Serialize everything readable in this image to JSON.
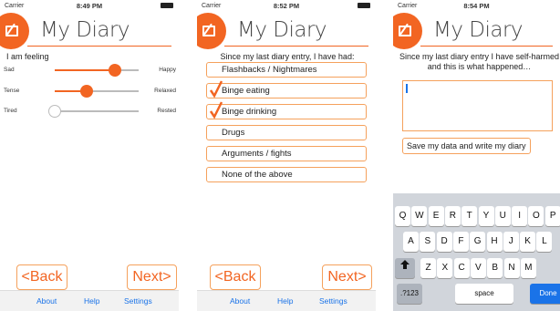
{
  "screens": [
    {
      "status": {
        "carrier": "Carrier",
        "time": "8:49 PM"
      },
      "app_title": "My Diary",
      "feeling": {
        "title": "I am feeling",
        "sliders": [
          {
            "left": "Sad",
            "right": "Happy",
            "value": 0.72
          },
          {
            "left": "Tense",
            "right": "Relaxed",
            "value": 0.38
          },
          {
            "left": "Tired",
            "right": "Rested",
            "value": 0.0
          }
        ]
      },
      "back": "<Back",
      "next": "Next>",
      "tabs": [
        "About",
        "Help",
        "Settings"
      ]
    },
    {
      "status": {
        "carrier": "Carrier",
        "time": "8:52 PM"
      },
      "app_title": "My Diary",
      "question": "Since my last diary entry, I have had:",
      "options": [
        {
          "label": "Flashbacks / Nightmares",
          "checked": false
        },
        {
          "label": "Binge eating",
          "checked": true
        },
        {
          "label": "Binge drinking",
          "checked": true
        },
        {
          "label": "Drugs",
          "checked": false
        },
        {
          "label": "Arguments / fights",
          "checked": false
        },
        {
          "label": "None of the above",
          "checked": false
        }
      ],
      "back": "<Back",
      "next": "Next>",
      "tabs": [
        "About",
        "Help",
        "Settings"
      ]
    },
    {
      "status": {
        "carrier": "Carrier",
        "time": "8:54 PM"
      },
      "app_title": "My Diary",
      "question": "Since my last diary entry I have self-harmed and this is what happened…",
      "text_value": "",
      "save_button": "Save my data and write my diary",
      "keyboard": {
        "row1": [
          "Q",
          "W",
          "E",
          "R",
          "T",
          "Y",
          "U",
          "I",
          "O",
          "P"
        ],
        "row2": [
          "A",
          "S",
          "D",
          "F",
          "G",
          "H",
          "J",
          "K",
          "L"
        ],
        "row3": [
          "Z",
          "X",
          "C",
          "V",
          "B",
          "N",
          "M"
        ],
        "numbers": ".?123",
        "space": "space",
        "done": "Done"
      }
    }
  ],
  "colors": {
    "accent": "#f26522",
    "link": "#1a73e8"
  }
}
